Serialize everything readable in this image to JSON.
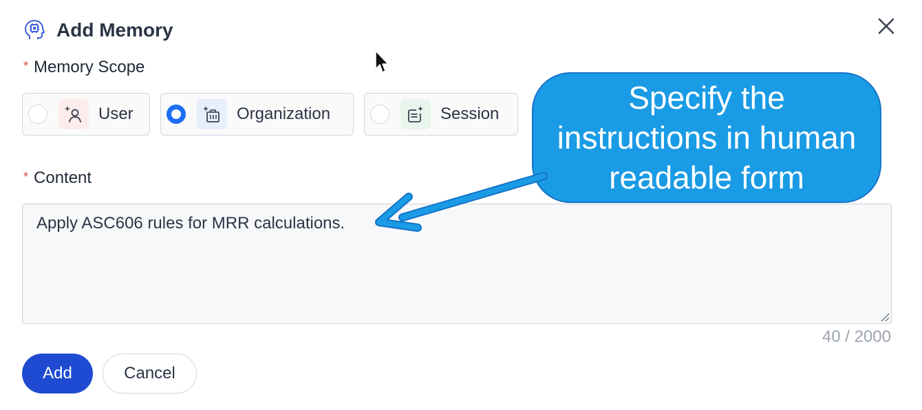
{
  "dialog": {
    "title": "Add Memory",
    "title_icon": "brain-chip-icon",
    "close_icon": "close-icon"
  },
  "scope": {
    "label": "Memory Scope",
    "required_mark": "*",
    "options": [
      {
        "label": "User",
        "icon": "user-sparkle-icon",
        "selected": false,
        "tile_color": "#fdecec"
      },
      {
        "label": "Organization",
        "icon": "building-sparkle-icon",
        "selected": true,
        "tile_color": "#e8eefb"
      },
      {
        "label": "Session",
        "icon": "session-sparkle-icon",
        "selected": false,
        "tile_color": "#e8f5ec"
      }
    ]
  },
  "content": {
    "label": "Content",
    "required_mark": "*",
    "value": "Apply ASC606 rules for MRR calculations.",
    "char_count": "40 / 2000"
  },
  "actions": {
    "add_label": "Add",
    "cancel_label": "Cancel"
  },
  "annotation": {
    "callout_text": "Specify the instructions in human readable form",
    "color": "#1a9be5"
  },
  "colors": {
    "primary": "#1e4bd1",
    "radio_selected": "#1d6ef5",
    "required": "#e0443a"
  }
}
